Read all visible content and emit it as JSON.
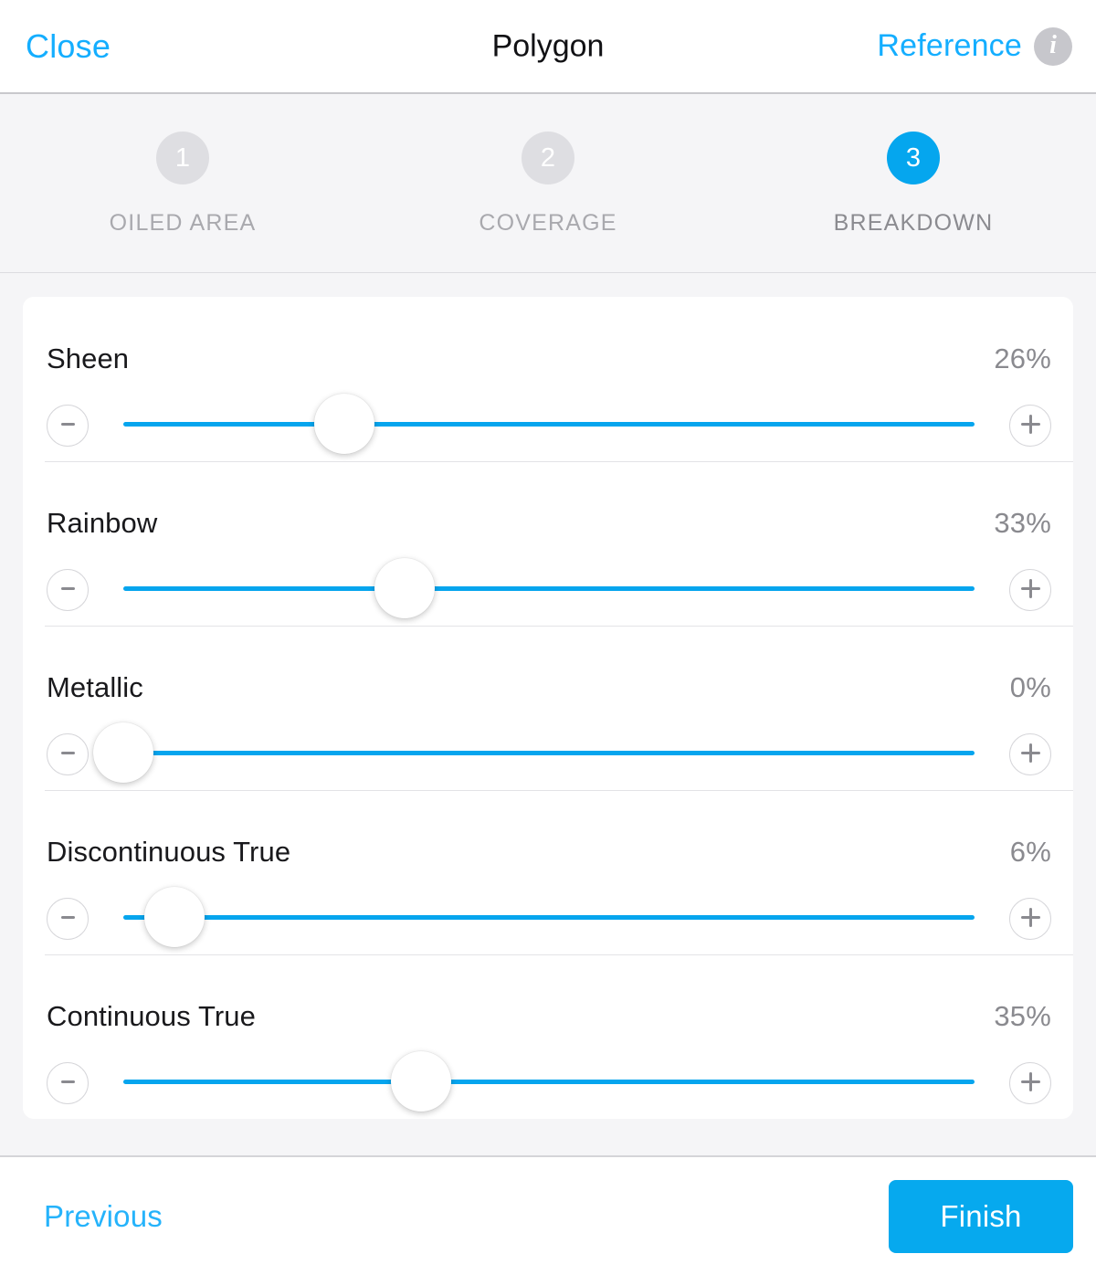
{
  "header": {
    "close_label": "Close",
    "title": "Polygon",
    "reference_label": "Reference",
    "info_icon": "info-icon",
    "info_glyph": "i"
  },
  "stepper": {
    "steps": [
      {
        "number": "1",
        "label": "OILED AREA",
        "active": false
      },
      {
        "number": "2",
        "label": "COVERAGE",
        "active": false
      },
      {
        "number": "3",
        "label": "BREAKDOWN",
        "active": true
      }
    ]
  },
  "sliders": [
    {
      "label": "Sheen",
      "value": "26%",
      "percent": 26,
      "minus_label": "-",
      "plus_label": "+"
    },
    {
      "label": "Rainbow",
      "value": "33%",
      "percent": 33,
      "minus_label": "-",
      "plus_label": "+"
    },
    {
      "label": "Metallic",
      "value": "0%",
      "percent": 0,
      "minus_label": "-",
      "plus_label": "+"
    },
    {
      "label": "Discontinuous True",
      "value": "6%",
      "percent": 6,
      "minus_label": "-",
      "plus_label": "+"
    },
    {
      "label": "Continuous True",
      "value": "35%",
      "percent": 35,
      "minus_label": "-",
      "plus_label": "+"
    }
  ],
  "footer": {
    "previous_label": "Previous",
    "finish_label": "Finish"
  },
  "colors": {
    "accent": "#06a9ee",
    "link": "#14aeff",
    "track": "#06a5ee",
    "step_inactive": "#dedee2",
    "panel_bg": "#f5f5f7"
  }
}
